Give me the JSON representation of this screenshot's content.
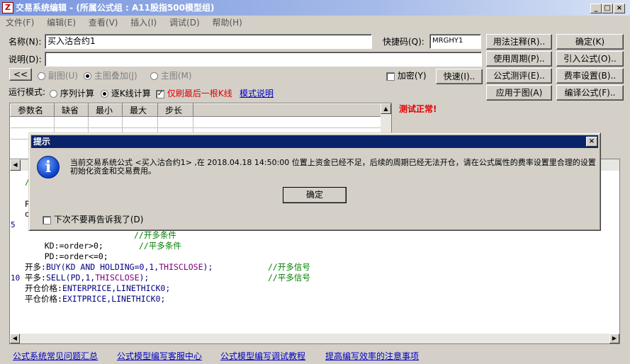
{
  "window": {
    "title": "交易系统编辑 - (所属公式组 : A11股指500模型组)",
    "app_icon": "Z"
  },
  "menu": [
    "文件(F)",
    "编辑(E)",
    "查看(V)",
    "插入(I)",
    "调试(D)",
    "帮助(H)"
  ],
  "form": {
    "name_label": "名称(N):",
    "name_value": "买入沽合约1",
    "shortcut_label": "快捷码(Q):",
    "shortcut_value": "MRGHY1",
    "desc_label": "说明(D):",
    "desc_value": "",
    "collapse_button": "<<",
    "view_options": [
      "副图(U)",
      "主图叠加(J)",
      "主图(M)"
    ],
    "encrypt_label": "加密(Y)",
    "fast_button": "快速(I)..",
    "mode_label": "运行模式:",
    "mode_options": [
      "序列计算",
      "逐K线计算"
    ],
    "only_last_label": "仅刷最后一根K线",
    "mode_help_link": "模式说明"
  },
  "buttons": {
    "usage_note": "用法注释(R)..",
    "confirm": "确定(K)",
    "use_period": "使用周期(P)..",
    "import_formula": "引入公式(O)..",
    "formula_test": "公式测评(E)..",
    "fee_settings": "费率设置(B)..",
    "apply_to_chart": "应用于图(A)",
    "compile_formula": "编译公式(F).."
  },
  "params_table": {
    "headers": [
      "参数名",
      "缺省",
      "最小",
      "最大",
      "步长"
    ]
  },
  "test_status": "测试正常!",
  "code": {
    "line_numbers": [
      "5",
      "10"
    ],
    "partial_lines": [
      "/",
      "P",
      "o"
    ],
    "lines": [
      {
        "text": "KD:=order>0;",
        "comment": "//开多条件"
      },
      {
        "text": "PD:=order<=0;",
        "comment": "//平多条件"
      },
      {
        "text": "",
        "comment": ""
      },
      {
        "label": "开多:",
        "fn": "BUY",
        "args": "(KD AND HOLDING=0,1,",
        "const": "THISCLOSE",
        "end": ");",
        "comment": "//开多信号"
      },
      {
        "label": "平多:",
        "fn": "SELL",
        "args": "(PD,1,",
        "const": "THISCLOSE",
        "end": ");",
        "comment": "//平多信号"
      },
      {
        "label": "开仓价格:",
        "fn": "ENTERPRICE",
        "args": ",",
        "const": "LINETHICK0",
        "end": ";",
        "comment": ""
      },
      {
        "label": "平仓价格:",
        "fn": "EXITPRICE",
        "args": ",",
        "const": "LINETHICK0",
        "end": ";",
        "comment": ""
      }
    ]
  },
  "dialog": {
    "title": "提示",
    "icon": "info-icon",
    "message": "当前交易系统公式 <买入沽合约1> ,在 2018.04.18 14:50:00 位置上资金已经不足，后续的周期已经无法开仓，请在公式属性的费率设置里合理的设置初始化资金和交易费用。",
    "ok_button": "确定",
    "dont_tell_label": "下次不要再告诉我了(D)"
  },
  "footer_links": [
    "公式系统常见问题汇总",
    "公式模型编写客服中心",
    "公式模型编写调试教程",
    "提高编写效率的注意事项"
  ]
}
